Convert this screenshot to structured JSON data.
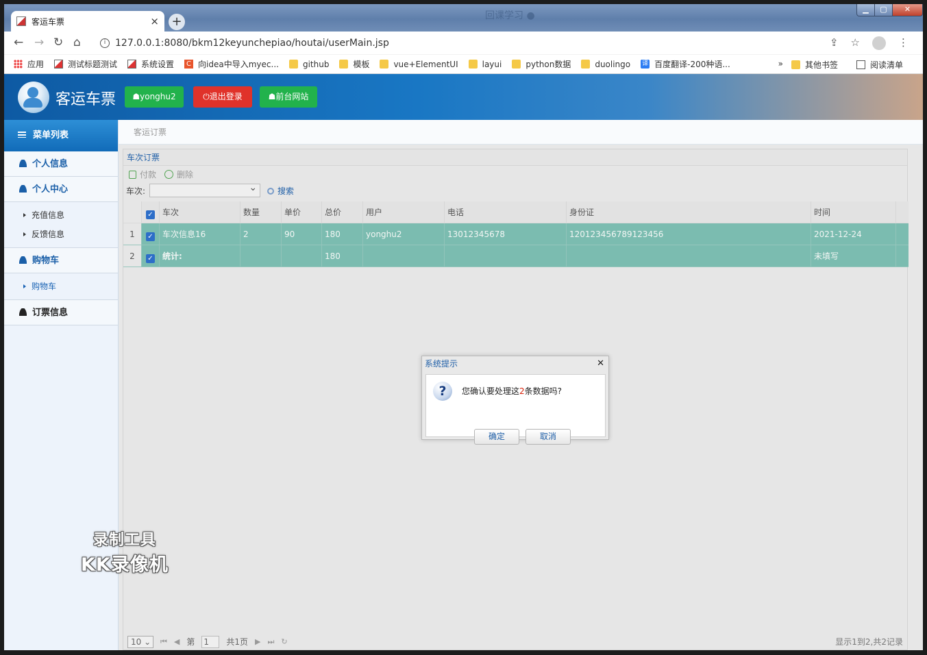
{
  "browser": {
    "tab_title": "客运车票",
    "blurred_title": "回课学习 ●",
    "url": "127.0.0.1:8080/bkm12keyunchepiao/houtai/userMain.jsp",
    "bookmarks": [
      {
        "label": "应用",
        "icon": "apps-icon"
      },
      {
        "label": "测试标题测试",
        "icon": "image-icon"
      },
      {
        "label": "系统设置",
        "icon": "image-icon"
      },
      {
        "label": "向idea中导入myec...",
        "icon": "c-icon"
      },
      {
        "label": "github",
        "icon": "folder-icon"
      },
      {
        "label": "模板",
        "icon": "folder-icon"
      },
      {
        "label": "vue+ElementUI",
        "icon": "folder-icon"
      },
      {
        "label": "layui",
        "icon": "folder-icon"
      },
      {
        "label": "python数据",
        "icon": "folder-icon"
      },
      {
        "label": "duolingo",
        "icon": "folder-icon"
      },
      {
        "label": "百度翻译-200种语...",
        "icon": "translate-icon"
      }
    ],
    "more": "»",
    "other_bookmarks": "其他书签",
    "reading_list": "阅读清单"
  },
  "header": {
    "title": "客运车票",
    "user_button": "yonghu2",
    "logout_button": "退出登录",
    "frontend_button": "前台网站"
  },
  "sidebar": {
    "menu_title": "菜单列表",
    "personal_info": "个人信息",
    "personal_center": "个人中心",
    "recharge": "充值信息",
    "feedback": "反馈信息",
    "cart_section": "购物车",
    "cart_item": "购物车",
    "orders": "订票信息"
  },
  "breadcrumb": "客运订票",
  "panel": {
    "title": "车次订票",
    "pay": "付款",
    "delete": "删除",
    "train_label": "车次:",
    "search": "搜索"
  },
  "grid": {
    "columns": [
      "车次",
      "数量",
      "单价",
      "总价",
      "用户",
      "电话",
      "身份证",
      "时间"
    ],
    "rows": [
      {
        "n": "1",
        "c": [
          "车次信息16",
          "2",
          "90",
          "180",
          "yonghu2",
          "13012345678",
          "120123456789123456",
          "2021-12-24"
        ]
      },
      {
        "n": "2",
        "c": [
          "统计:",
          "",
          "",
          "180",
          "",
          "",
          "",
          "未填写"
        ]
      }
    ]
  },
  "pager": {
    "page_size": "10",
    "page_prefix": "第",
    "page_value": "1",
    "total_pages": "共1页",
    "info": "显示1到2,共2记录"
  },
  "dialog": {
    "title": "系统提示",
    "msg_before": "您确认要处理这",
    "msg_count": "2",
    "msg_after": "条数据吗?",
    "ok": "确定",
    "cancel": "取消"
  },
  "watermark": {
    "line1": "录制工具",
    "line2": "KK录像机"
  },
  "colors": {
    "accent": "#1977c4",
    "selected_row": "#7bbcb0",
    "green": "#22b24c",
    "red": "#e0322a"
  }
}
